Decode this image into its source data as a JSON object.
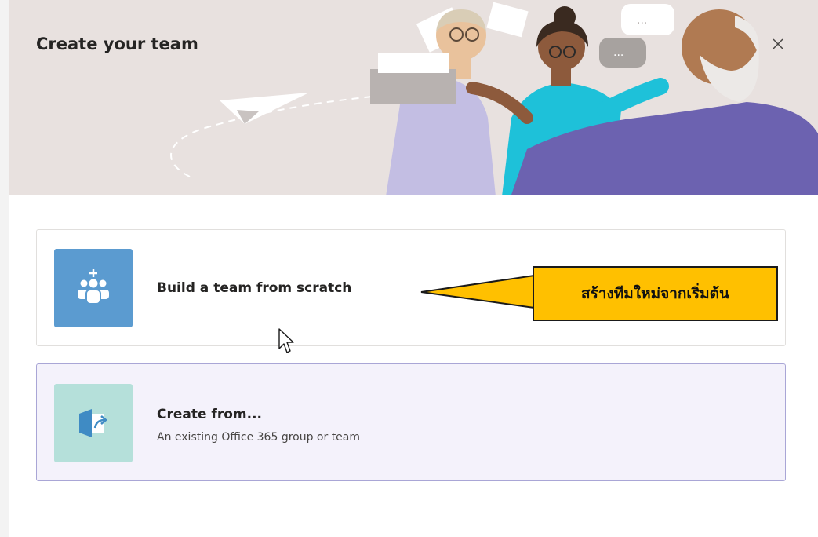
{
  "dialog": {
    "title": "Create your team",
    "close_icon": "close-icon"
  },
  "options": [
    {
      "label": "Build a team from scratch",
      "icon": "team-add-icon",
      "tile_color": "#5b9bd0"
    },
    {
      "label": "Create from...",
      "sublabel": "An existing Office 365 group or team",
      "icon": "create-from-icon",
      "tile_color": "#b5e0da"
    }
  ],
  "annotation": {
    "text": "สร้างทีมใหม่จากเริ่มต้น",
    "color": "#ffc000"
  },
  "colors": {
    "header_bg": "#e8e1df",
    "selected_card_bg": "#f4f2fb",
    "selected_card_border": "#a9a6d6"
  }
}
